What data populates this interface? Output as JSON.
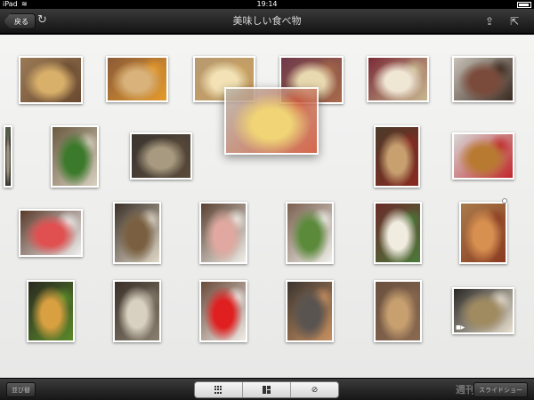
{
  "status": {
    "carrier": "iPad",
    "time": "19:14"
  },
  "nav": {
    "back_label": "戻る",
    "title": "美味しい食べ物"
  },
  "toolbar": {
    "sort_label": "並び替",
    "slideshow_label": "スライドショー",
    "watermark": "週刊"
  },
  "photos": [
    {
      "name": "potato-food-photo",
      "colors": [
        "#9a7a55",
        "#d9b06a",
        "#6a4a30"
      ]
    },
    {
      "name": "pear-photo",
      "colors": [
        "#8a5a38",
        "#d8b27a",
        "#e59a2a"
      ]
    },
    {
      "name": "tofu-photo",
      "colors": [
        "#b89a70",
        "#f2e2b5",
        "#c8a060"
      ]
    },
    {
      "name": "rice-plate-photo",
      "colors": [
        "#6e3a4a",
        "#e8d9b0",
        "#a86a4a"
      ]
    },
    {
      "name": "soup-cup-photo",
      "colors": [
        "#7a2a35",
        "#efe6d4",
        "#c8b890"
      ]
    },
    {
      "name": "grilled-fish-photo",
      "colors": [
        "#c8c2b8",
        "#7a4a3a",
        "#3a2a20"
      ]
    },
    {
      "name": "partial-photo",
      "colors": [
        "#55604a",
        "#a09080",
        "#303028"
      ]
    },
    {
      "name": "herb-salad-photo",
      "colors": [
        "#6a5a40",
        "#3a7a2a",
        "#d8d0c0"
      ]
    },
    {
      "name": "oysters-photo",
      "colors": [
        "#3a3530",
        "#a89a80",
        "#5a4a3a"
      ]
    },
    {
      "name": "omelet-plate-photo",
      "colors": [
        "#b8b4a8",
        "#f0d060",
        "#d05030"
      ]
    },
    {
      "name": "bento-box-photo",
      "colors": [
        "#4a3a2a",
        "#c8a070",
        "#8a2a20"
      ]
    },
    {
      "name": "taiyaki-photo",
      "colors": [
        "#d8d8d8",
        "#b87a30",
        "#c0282a"
      ]
    },
    {
      "name": "tuna-sashimi-photo",
      "colors": [
        "#5a3a2a",
        "#e05050",
        "#f0f0f0"
      ]
    },
    {
      "name": "sushi-plate-photo",
      "colors": [
        "#3a3028",
        "#7a6040",
        "#e0d8c8"
      ]
    },
    {
      "name": "ham-plate-photo",
      "colors": [
        "#5a4030",
        "#e0a8a0",
        "#f0f0ea"
      ]
    },
    {
      "name": "hamburg-plate-photo",
      "colors": [
        "#7a6050",
        "#5a8a3a",
        "#f0f0ea"
      ]
    },
    {
      "name": "decorated-plate-photo",
      "colors": [
        "#6a2a2a",
        "#f0ece0",
        "#4a7a3a"
      ]
    },
    {
      "name": "pizza-photo",
      "colors": [
        "#a87a4a",
        "#d89050",
        "#8a3a20"
      ]
    },
    {
      "name": "fried-food-photo",
      "colors": [
        "#2a2a20",
        "#d8a040",
        "#5a8a2a"
      ]
    },
    {
      "name": "soft-serve-photo",
      "colors": [
        "#3a3028",
        "#d8d0c0",
        "#8a8070"
      ]
    },
    {
      "name": "dolls-photo",
      "colors": [
        "#6a4a3a",
        "#e02020",
        "#f0ece8"
      ]
    },
    {
      "name": "grill-table-photo",
      "colors": [
        "#3a3430",
        "#5a5450",
        "#c89060"
      ]
    },
    {
      "name": "baked-goods-photo",
      "colors": [
        "#6a5040",
        "#c8a070",
        "#8a6a50"
      ]
    },
    {
      "name": "video-thumb-photo",
      "colors": [
        "#2a2824",
        "#a08a60",
        "#e8e0d0"
      ]
    }
  ]
}
